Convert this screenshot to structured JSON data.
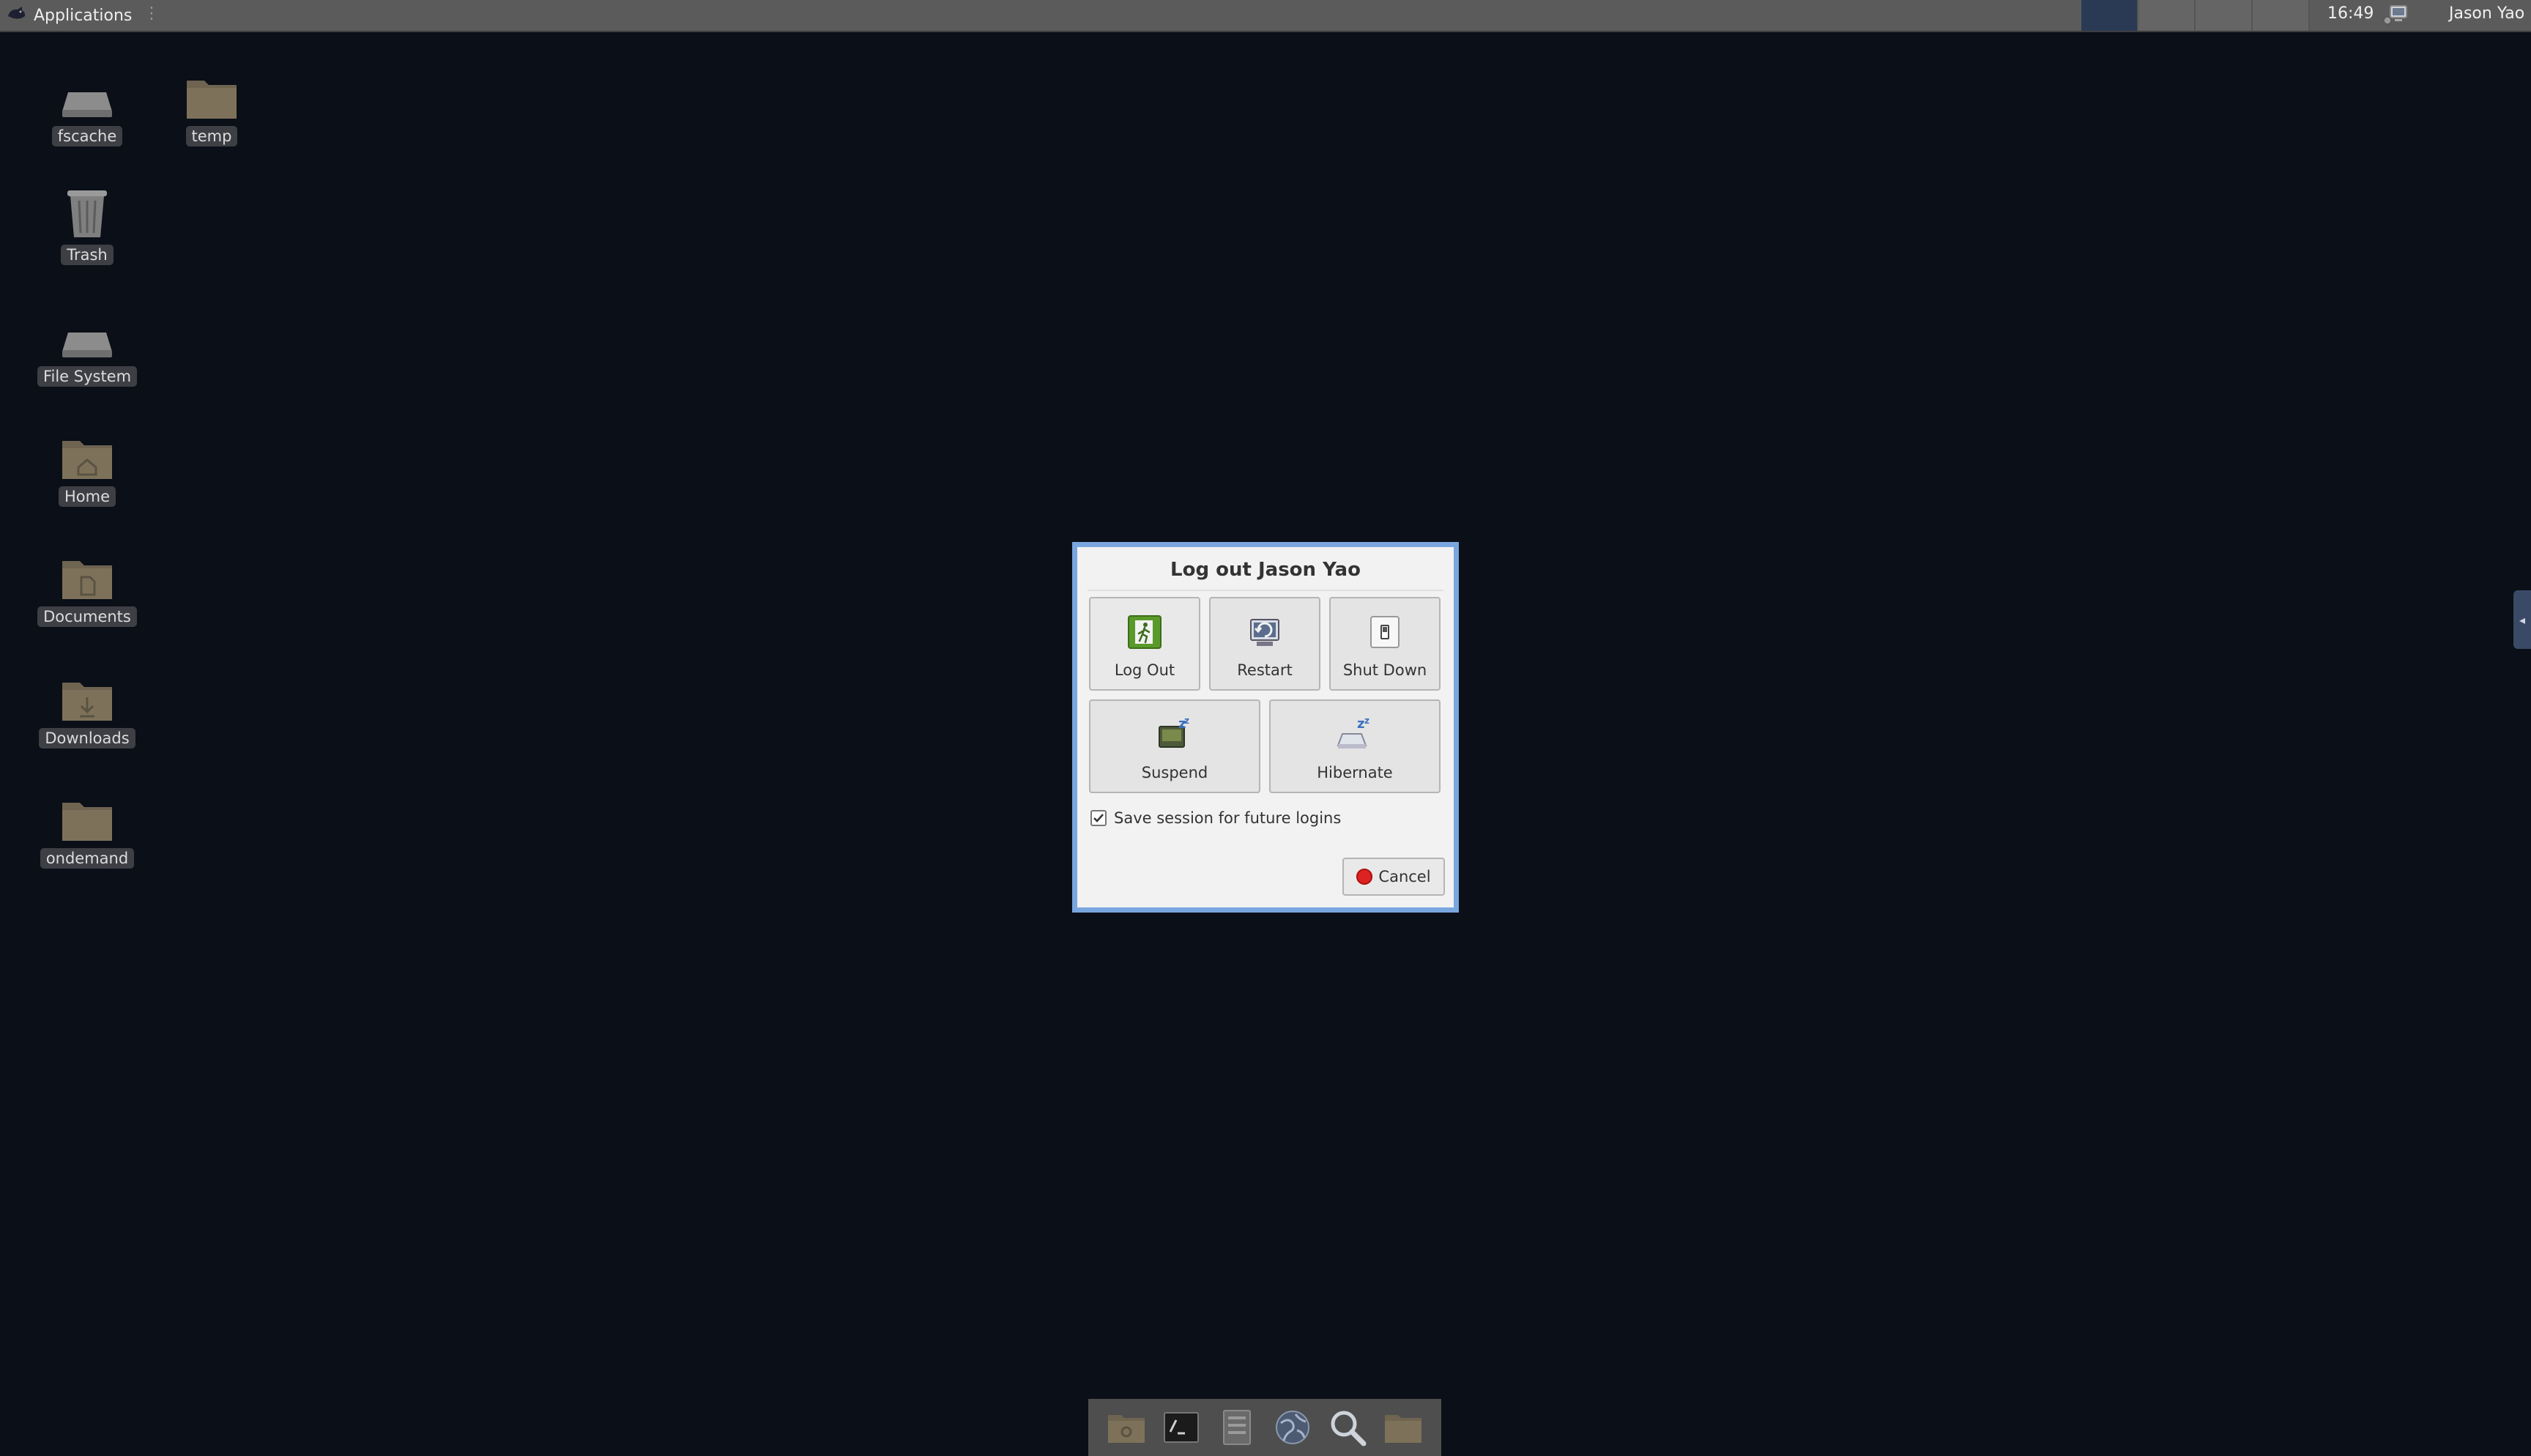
{
  "top_panel": {
    "applications_label": "Applications",
    "clock": "16:49",
    "user_name": "Jason Yao",
    "workspaces": [
      "1",
      "2",
      "3",
      "4"
    ],
    "active_workspace": 0
  },
  "desktop_icons": [
    {
      "label": "fscache",
      "icon": "drive-icon"
    },
    {
      "label": "temp",
      "icon": "folder-icon"
    },
    {
      "label": "Trash",
      "icon": "trash-icon"
    },
    {
      "label": "File System",
      "icon": "drive-icon"
    },
    {
      "label": "Home",
      "icon": "home-folder-icon"
    },
    {
      "label": "Documents",
      "icon": "documents-folder-icon"
    },
    {
      "label": "Downloads",
      "icon": "downloads-folder-icon"
    },
    {
      "label": "ondemand",
      "icon": "folder-icon"
    }
  ],
  "dialog": {
    "title": "Log out Jason Yao",
    "buttons": {
      "log_out": "Log Out",
      "restart": "Restart",
      "shut_down": "Shut Down",
      "suspend": "Suspend",
      "hibernate": "Hibernate"
    },
    "save_session_label": "Save session for future logins",
    "save_session_checked": true,
    "cancel_label": "Cancel"
  },
  "dock": [
    "file-manager-icon",
    "terminal-icon",
    "drive-icon",
    "web-browser-icon",
    "search-icon",
    "folder-icon"
  ],
  "colors": {
    "desktop_bg": "#0a0f18",
    "panel_bg": "#5b5b5b",
    "dialog_border": "#7aa6e0",
    "cancel_red": "#dd2222"
  }
}
